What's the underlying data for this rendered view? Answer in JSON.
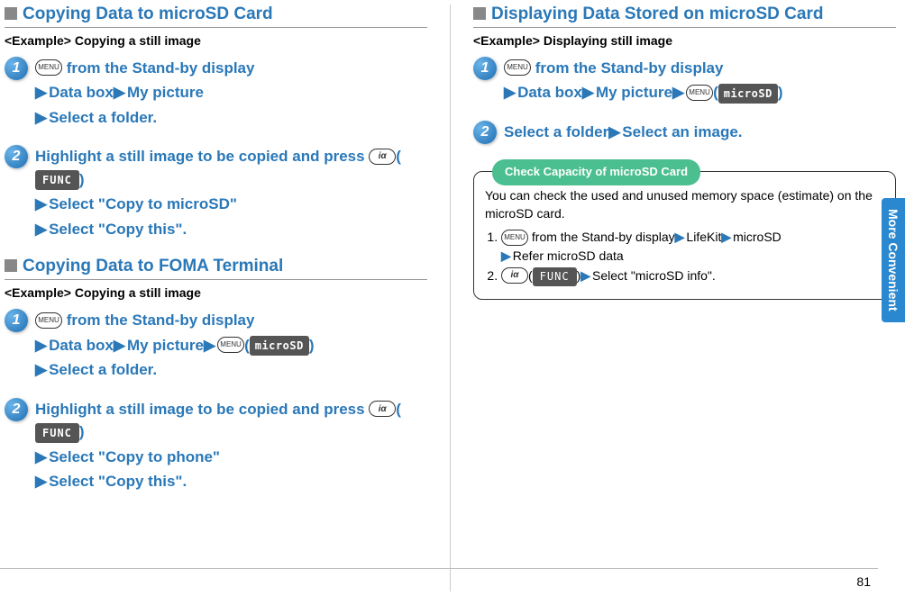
{
  "side_tab": {
    "label": "More Convenient"
  },
  "page_number": "81",
  "left": {
    "section1": {
      "title": "Copying Data to microSD Card",
      "example": "<Example> Copying a still image",
      "step1": {
        "menu_label": "MENU",
        "line1_tail": " from the Stand-by display",
        "line2": "Data box",
        "line2b": "My picture",
        "line3": "Select a folder."
      },
      "step2": {
        "line1": "Highlight a still image to be copied and press ",
        "i_label": "iα",
        "func_label": "FUNC",
        "line2": "Select \"Copy to microSD\"",
        "line3": "Select \"Copy this\"."
      }
    },
    "section2": {
      "title": "Copying Data to FOMA Terminal",
      "example": "<Example> Copying a still image",
      "step1": {
        "menu_label": "MENU",
        "line1_tail": " from the Stand-by display",
        "line2": "Data box",
        "line2b": "My picture",
        "microsd_label": "microSD",
        "line3": "Select a folder."
      },
      "step2": {
        "line1": "Highlight a still image to be copied and press ",
        "i_label": "iα",
        "func_label": "FUNC",
        "line2": "Select \"Copy to phone\"",
        "line3": "Select \"Copy this\"."
      }
    }
  },
  "right": {
    "section1": {
      "title": "Displaying Data Stored on microSD Card",
      "example": "<Example> Displaying still image",
      "step1": {
        "menu_label": "MENU",
        "line1_tail": " from the Stand-by display",
        "line2": "Data box",
        "line2b": "My picture",
        "microsd_label": "microSD"
      },
      "step2": {
        "line1": "Select a folder",
        "line1b": "Select an image."
      }
    },
    "tip": {
      "title": "Check Capacity of microSD Card",
      "intro": "You can check the used and unused memory space (estimate) on the microSD card.",
      "li1_menu": "MENU",
      "li1_text": " from the Stand-by display",
      "li1_a": "LifeKit",
      "li1_b": "microSD",
      "li1_c": "Refer microSD data",
      "li2_i": "iα",
      "li2_func": "FUNC",
      "li2_text": "Select \"microSD info\"."
    }
  }
}
